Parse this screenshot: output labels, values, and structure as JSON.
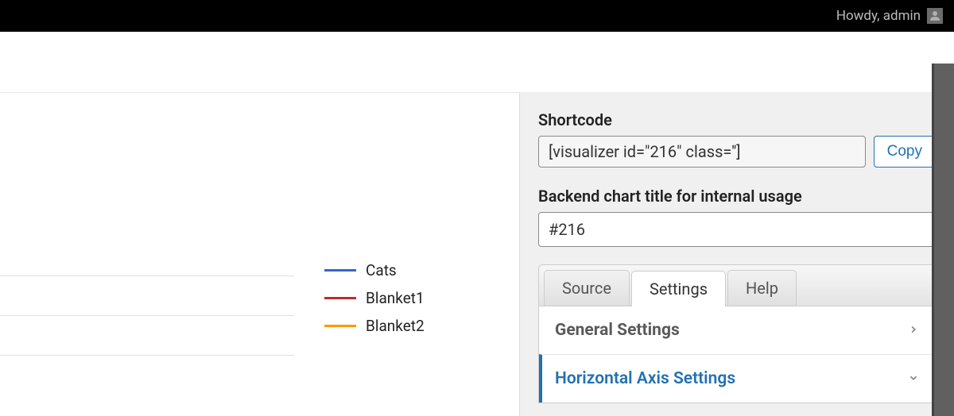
{
  "adminBar": {
    "greeting": "Howdy, admin"
  },
  "legend": {
    "items": [
      {
        "label": "Cats",
        "color": "#3366cc"
      },
      {
        "label": "Blanket1",
        "color": "#b82e2e"
      },
      {
        "label": "Blanket2",
        "color": "#ff9900"
      }
    ]
  },
  "sidebar": {
    "shortcodeLabel": "Shortcode",
    "shortcodeValue": "[visualizer id=\"216\" class='']",
    "copyLabel": "Copy",
    "backendTitleLabel": "Backend chart title for internal usage",
    "backendTitleValue": "#216",
    "tabs": {
      "source": "Source",
      "settings": "Settings",
      "help": "Help"
    },
    "accordion": {
      "general": "General Settings",
      "horizontal": "Horizontal Axis Settings"
    }
  }
}
